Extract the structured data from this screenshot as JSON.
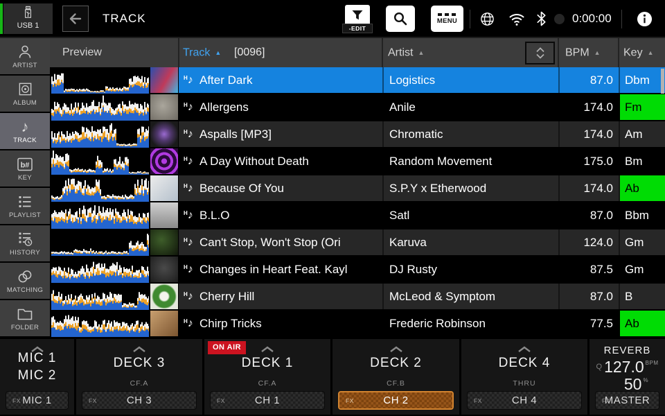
{
  "topbar": {
    "usb_label": "USB 1",
    "title": "TRACK",
    "edit_label": "-EDIT",
    "menu_label": "MENU",
    "time": "0:00:00"
  },
  "sidebar": {
    "items": [
      {
        "label": "ARTIST",
        "icon": "artist-icon",
        "selected": false
      },
      {
        "label": "ALBUM",
        "icon": "album-icon",
        "selected": false
      },
      {
        "label": "TRACK",
        "icon": "track-icon",
        "selected": true
      },
      {
        "label": "KEY",
        "icon": "key-icon",
        "selected": false
      },
      {
        "label": "PLAYLIST",
        "icon": "playlist-icon",
        "selected": false
      },
      {
        "label": "HISTORY",
        "icon": "history-icon",
        "selected": false
      },
      {
        "label": "MATCHING",
        "icon": "matching-icon",
        "selected": false
      },
      {
        "label": "FOLDER",
        "icon": "folder-icon",
        "selected": false
      }
    ]
  },
  "table": {
    "headers": {
      "preview": "Preview",
      "track": "Track",
      "track_count": "[0096]",
      "artist": "Artist",
      "bpm": "BPM",
      "key": "Key",
      "sort_arrow": "▲"
    },
    "note_badge": "H",
    "note_glyph": "♪",
    "rows": [
      {
        "title": "After Dark",
        "artist": "Logistics",
        "bpm": "87.0",
        "key": "Dbm",
        "selected": true,
        "key_match": false,
        "art": "linear-gradient(120deg,#2a4fae,#c03a5a 55%,#3fb8e8)"
      },
      {
        "title": "Allergens",
        "artist": "Anile",
        "bpm": "174.0",
        "key": "Fm",
        "selected": false,
        "key_match": true,
        "art": "radial-gradient(circle at 45% 45%,#aaa69c,#6e6a62)"
      },
      {
        "title": "Aspalls [MP3]",
        "artist": "Chromatic",
        "bpm": "174.0",
        "key": "Am",
        "selected": false,
        "key_match": false,
        "art": "radial-gradient(circle at 50% 50%,#9a6ad0 0%,#51386e 35%,#1a1a1a 75%)"
      },
      {
        "title": "A Day Without Death",
        "artist": "Random Movement",
        "bpm": "175.0",
        "key": "Bm",
        "selected": false,
        "key_match": false,
        "art": "repeating-radial-gradient(circle at 50% 50%,#b03ae0 0 4px,#2a0a3a 4px 9px)"
      },
      {
        "title": "Because Of You",
        "artist": "S.P.Y x Etherwood",
        "bpm": "174.0",
        "key": "Ab",
        "selected": false,
        "key_match": true,
        "art": "linear-gradient(135deg,#ececec,#b4c0cc)"
      },
      {
        "title": "B.L.O",
        "artist": "Satl",
        "bpm": "87.0",
        "key": "Bbm",
        "selected": false,
        "key_match": false,
        "art": "linear-gradient(180deg,#d0d0d0,#8a8a8a)"
      },
      {
        "title": "Can't Stop, Won't Stop (Ori",
        "artist": "Karuva",
        "bpm": "124.0",
        "key": "Gm",
        "selected": false,
        "key_match": false,
        "art": "radial-gradient(circle at 40% 40%,#3e5e2a,#10160a)"
      },
      {
        "title": "Changes in Heart Feat. Kayl",
        "artist": "DJ Rusty",
        "bpm": "87.5",
        "key": "Gm",
        "selected": false,
        "key_match": false,
        "art": "radial-gradient(circle at 50% 45%,#4a4a4a,#1c1c1c)"
      },
      {
        "title": "Cherry Hill",
        "artist": "McLeod & Symptom",
        "bpm": "87.0",
        "key": "B",
        "selected": false,
        "key_match": false,
        "art": "radial-gradient(circle at 50% 50%,#f4f4ec 0 22%,#3f8a30 30% 58%,#e4e8dc 66%)"
      },
      {
        "title": "Chirp Tricks",
        "artist": "Frederic Robinson",
        "bpm": "77.5",
        "key": "Ab",
        "selected": false,
        "key_match": true,
        "art": "linear-gradient(135deg,#c9a070,#7c5530)"
      }
    ]
  },
  "mixer": {
    "fx_label": "FX",
    "panels": [
      {
        "names": [
          "MIC 1",
          "MIC 2"
        ],
        "sub": "",
        "fx_value": "MIC 1",
        "on_air": "",
        "fx_active": false
      },
      {
        "names": [
          "DECK 3"
        ],
        "sub": "CF.A",
        "fx_value": "CH 3",
        "on_air": "",
        "fx_active": false
      },
      {
        "names": [
          "DECK 1"
        ],
        "sub": "CF.A",
        "fx_value": "CH 1",
        "on_air": "ON AIR",
        "fx_active": false
      },
      {
        "names": [
          "DECK 2"
        ],
        "sub": "CF.B",
        "fx_value": "CH 2",
        "on_air": "",
        "fx_active": true
      },
      {
        "names": [
          "DECK 4"
        ],
        "sub": "THRU",
        "fx_value": "CH 4",
        "on_air": "",
        "fx_active": false
      }
    ],
    "fx": {
      "name": "REVERB",
      "q": "Q",
      "bpm_value": "127.0",
      "bpm_unit": "BPM",
      "percent": "50",
      "percent_unit": "%",
      "fx_label": "FX",
      "fx_value": "MASTER"
    }
  },
  "colors": {
    "selected_row_blue": "#1583df",
    "track_header_blue": "#41a3f0",
    "key_match_green": "#00dc04",
    "on_air_red": "#cc1320",
    "fx_active_orange": "#d2832f",
    "usb_green": "#17b517",
    "wave_blue": "#2465cf",
    "wave_orange": "#eea226"
  }
}
